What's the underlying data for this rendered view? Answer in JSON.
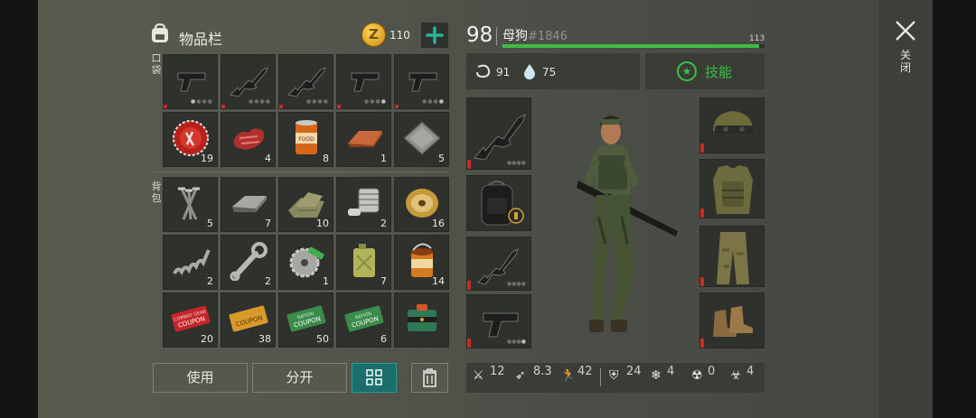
{
  "inventory": {
    "title": "物品栏",
    "coin_count": "110",
    "pocket_label": "口袋",
    "backpack_label": "背包",
    "pocket_slots": [
      {
        "icon": "pistol-icon",
        "count": ""
      },
      {
        "icon": "assault-rifle-icon",
        "count": ""
      },
      {
        "icon": "assault-rifle-icon",
        "count": ""
      },
      {
        "icon": "pistol-icon",
        "count": ""
      },
      {
        "icon": "pistol-icon",
        "count": ""
      },
      {
        "icon": "bottle-cap-icon",
        "count": "19"
      },
      {
        "icon": "raw-meat-icon",
        "count": "4"
      },
      {
        "icon": "canned-food-icon",
        "count": "8"
      },
      {
        "icon": "copper-ingot-icon",
        "count": "1"
      },
      {
        "icon": "steel-plate-icon",
        "count": "5"
      }
    ],
    "backpack_slots": [
      {
        "icon": "nails-icon",
        "count": "5"
      },
      {
        "icon": "iron-bar-icon",
        "count": "7"
      },
      {
        "icon": "fabric-icon",
        "count": "10"
      },
      {
        "icon": "engine-parts-icon",
        "count": "2"
      },
      {
        "icon": "wire-spool-icon",
        "count": "16"
      },
      {
        "icon": "spring-icon",
        "count": "2"
      },
      {
        "icon": "wrench-icon",
        "count": "2"
      },
      {
        "icon": "saw-blade-icon",
        "count": "1"
      },
      {
        "icon": "jerrycan-icon",
        "count": "7"
      },
      {
        "icon": "open-can-icon",
        "count": "14"
      },
      {
        "icon": "combat-gear-coupon-icon",
        "count": "20",
        "coupon_top": "COMBAT GEAR",
        "coupon_text": "COUPON"
      },
      {
        "icon": "gold-coupon-icon",
        "count": "38",
        "coupon_top": "",
        "coupon_text": "COUPON"
      },
      {
        "icon": "ration-coupon-icon",
        "count": "50",
        "coupon_top": "RATION",
        "coupon_text": "COUPON"
      },
      {
        "icon": "ration-coupon-icon",
        "count": "6",
        "coupon_top": "RATION",
        "coupon_text": "COUPON"
      },
      {
        "icon": "supply-crate-icon",
        "count": ""
      }
    ],
    "buttons": {
      "use": "使用",
      "split": "分开"
    }
  },
  "character": {
    "level": "98",
    "name": "母狗",
    "id": "#1846",
    "xp_max": "113",
    "xp_fraction": 0.98,
    "hunger": "91",
    "thirst": "75",
    "skills_label": "技能",
    "stats": [
      {
        "icon": "melee-damage-icon",
        "value": "12"
      },
      {
        "icon": "ranged-damage-icon",
        "value": "8.3"
      },
      {
        "icon": "speed-icon",
        "value": "42"
      },
      {
        "icon": "defense-icon",
        "value": "24"
      },
      {
        "icon": "cold-resist-icon",
        "value": "4"
      },
      {
        "icon": "radiation-resist-icon",
        "value": "0"
      },
      {
        "icon": "infection-resist-icon",
        "value": "4"
      }
    ]
  },
  "close_label": "关闭",
  "colors": {
    "accent_green": "#3dbf45",
    "teal": "#1d8f8a",
    "red_marker": "#c92b2b",
    "coin_gold": "#e0a81d"
  }
}
